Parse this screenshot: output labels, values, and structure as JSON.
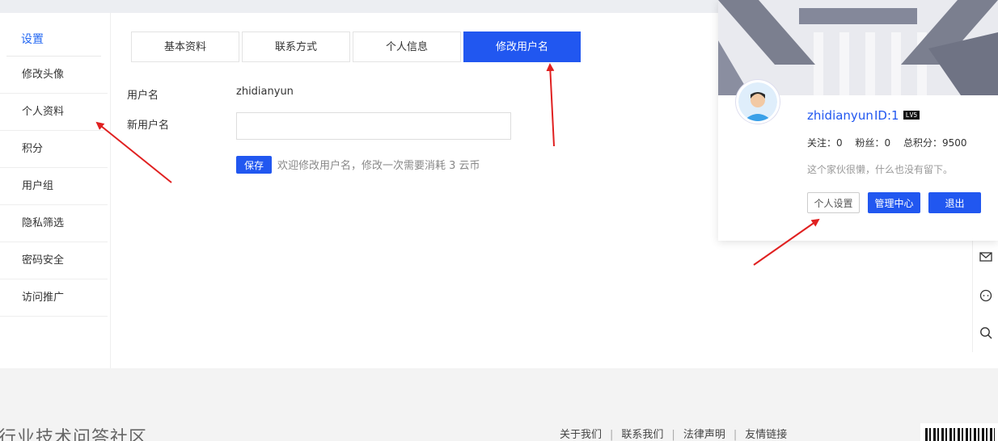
{
  "sidebar": {
    "title": "设置",
    "items": [
      {
        "label": "修改头像"
      },
      {
        "label": "个人资料"
      },
      {
        "label": "积分"
      },
      {
        "label": "用户组"
      },
      {
        "label": "隐私筛选"
      },
      {
        "label": "密码安全"
      },
      {
        "label": "访问推广"
      }
    ]
  },
  "tabs": [
    {
      "label": "基本资料"
    },
    {
      "label": "联系方式"
    },
    {
      "label": "个人信息"
    },
    {
      "label": "修改用户名",
      "active": true
    }
  ],
  "form": {
    "username_label": "用户名",
    "username_value": "zhidianyun",
    "new_username_label": "新用户名",
    "new_username_value": "",
    "save_label": "保存",
    "hint": "欢迎修改用户名，修改一次需要消耗 3 云币"
  },
  "profile": {
    "name": "zhidianyun",
    "id_text": "ID:1",
    "level_badge": "LV5",
    "follow": "关注：0",
    "fans": "粉丝：0",
    "points": "总积分：9500",
    "bio": "这个家伙很懒，什么也没有留下。",
    "btn_settings": "个人设置",
    "btn_admin": "管理中心",
    "btn_logout": "退出"
  },
  "footer": {
    "title": "行业技术问答社区",
    "links": [
      "关于我们",
      "联系我们",
      "法律声明",
      "友情链接"
    ]
  },
  "colors": {
    "accent": "#2157f0",
    "annotation_arrow": "#e02020"
  },
  "side_tools": [
    "mail-icon",
    "chat-icon",
    "search-icon"
  ]
}
